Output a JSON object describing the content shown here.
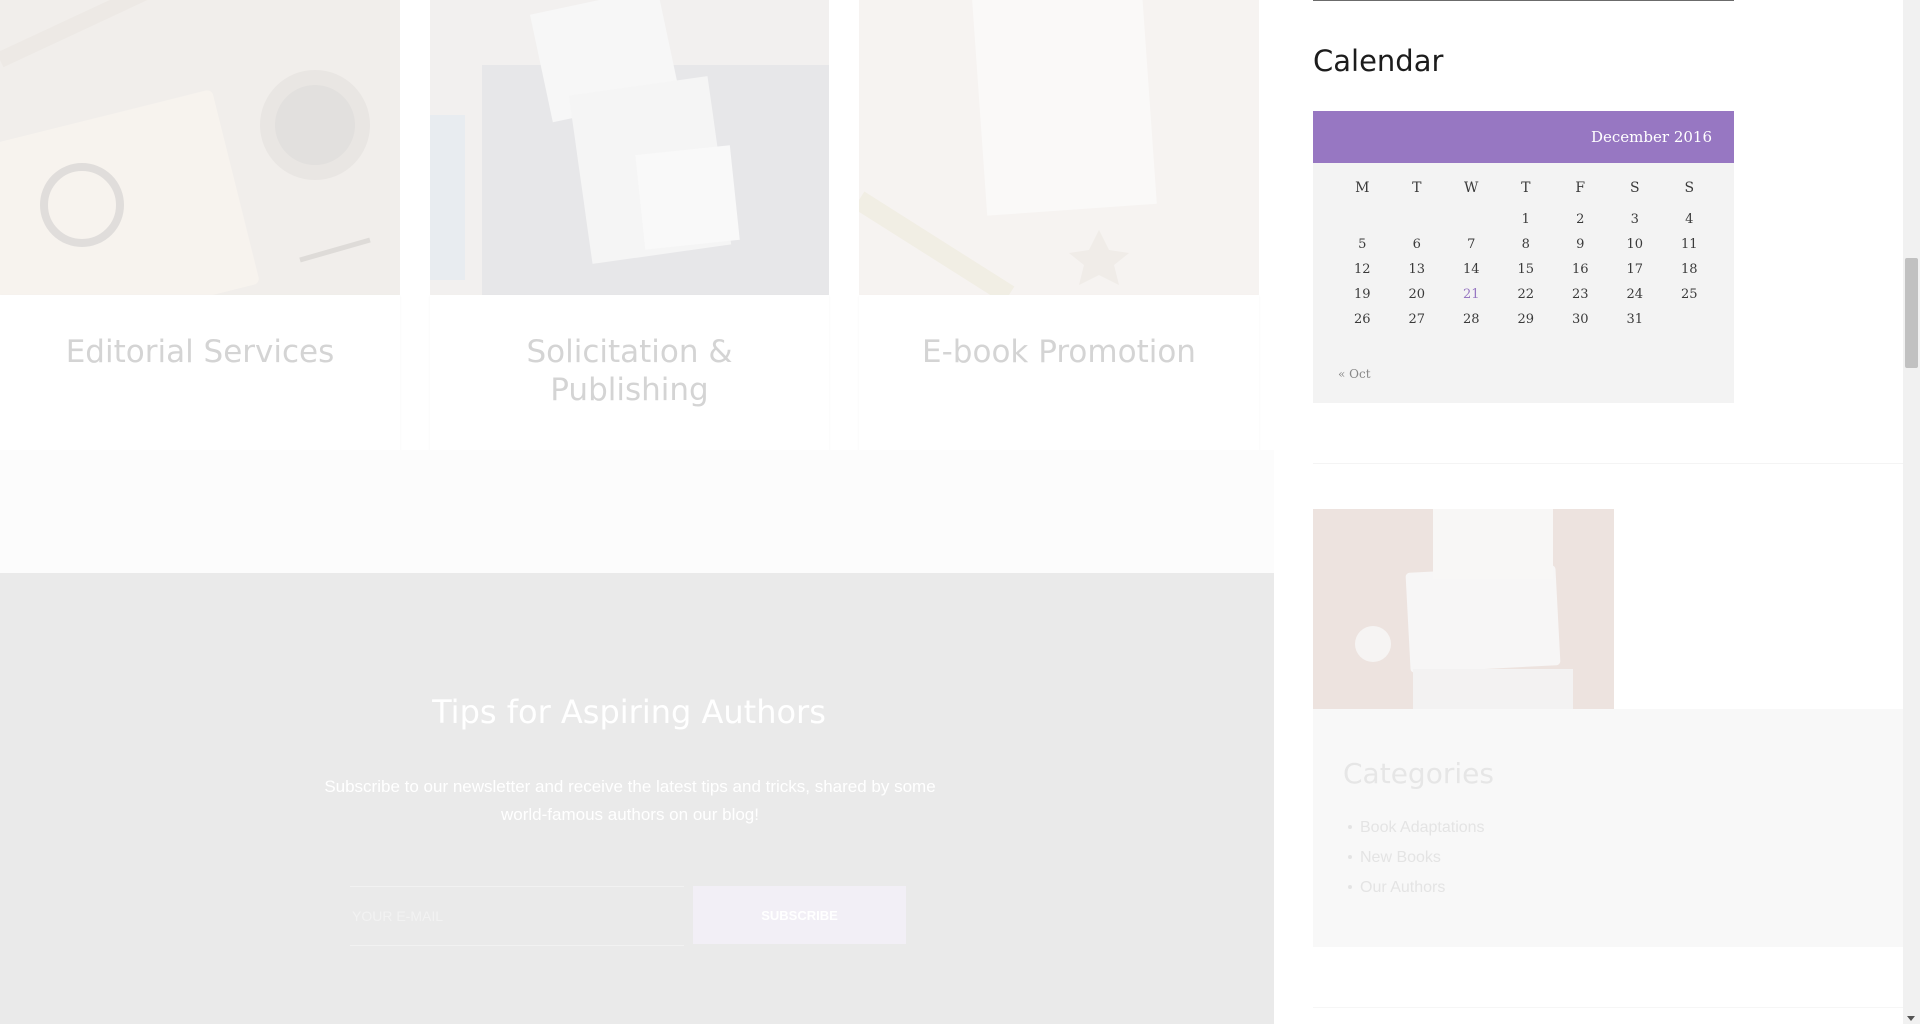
{
  "services": [
    {
      "title": "Editorial Services"
    },
    {
      "title": "Solicitation & Publishing"
    },
    {
      "title": "E-book Promotion"
    }
  ],
  "newsletter": {
    "title": "Tips for Aspiring Authors",
    "text": "Subscribe to our newsletter and receive the latest tips and tricks, shared by some world-famous authors on our blog!",
    "email_placeholder": "YOUR E-MAIL",
    "button_label": "SUBSCRIBE"
  },
  "calendar": {
    "title": "Calendar",
    "caption": "December 2016",
    "weekdays": [
      "M",
      "T",
      "W",
      "T",
      "F",
      "S",
      "S"
    ],
    "weeks": [
      [
        "",
        "",
        "",
        "1",
        "2",
        "3",
        "4"
      ],
      [
        "5",
        "6",
        "7",
        "8",
        "9",
        "10",
        "11"
      ],
      [
        "12",
        "13",
        "14",
        "15",
        "16",
        "17",
        "18"
      ],
      [
        "19",
        "20",
        "21",
        "22",
        "23",
        "24",
        "25"
      ],
      [
        "26",
        "27",
        "28",
        "29",
        "30",
        "31",
        ""
      ]
    ],
    "today": "21",
    "prev_link": "« Oct",
    "accent_color": "#9777c2"
  },
  "categories": {
    "title": "Categories",
    "items": [
      "Book Adaptations",
      "New Books",
      "Our Authors"
    ]
  }
}
